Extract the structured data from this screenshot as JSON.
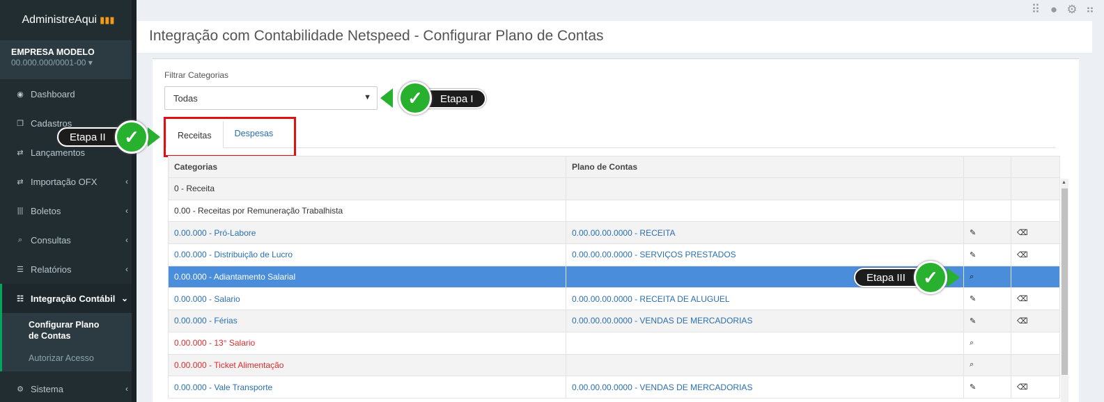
{
  "app": {
    "brand": "AdministreAqui"
  },
  "company": {
    "name": "EMPRESA MODELO",
    "cnpj": "00.000.000/0001-00"
  },
  "sidebar": {
    "items": [
      {
        "label": "Dashboard",
        "icon": "dashboard-icon"
      },
      {
        "label": "Cadastros",
        "icon": "copy-icon"
      },
      {
        "label": "Lançamentos",
        "icon": "exchange-icon"
      },
      {
        "label": "Importação OFX",
        "icon": "exchange-icon"
      },
      {
        "label": "Boletos",
        "icon": "barcode-icon"
      },
      {
        "label": "Consultas",
        "icon": "search-icon"
      },
      {
        "label": "Relatórios",
        "icon": "list-icon"
      },
      {
        "label": "Integração Contábil",
        "icon": "table-icon"
      },
      {
        "label": "Sistema",
        "icon": "gears-icon"
      }
    ],
    "submenu": [
      {
        "label": "Configurar Plano de Contas"
      },
      {
        "label": "Autorizar Acesso"
      }
    ]
  },
  "page": {
    "title": "Integração com Contabilidade Netspeed - Configurar Plano de Contas"
  },
  "filter": {
    "label": "Filtrar Categorias",
    "selected": "Todas"
  },
  "tabs": {
    "receitas": "Receitas",
    "despesas": "Despesas"
  },
  "table": {
    "headers": [
      "Categorias",
      "Plano de Contas",
      "",
      ""
    ],
    "rows": [
      {
        "cat": "0 - Receita",
        "plano": ""
      },
      {
        "cat": "0.00 - Receitas por Remuneração Trabalhista",
        "plano": ""
      },
      {
        "cat": "0.00.000 - Pró-Labore",
        "plano": "0.00.00.00.0000 - RECEITA"
      },
      {
        "cat": "0.00.000 - Distribuição de Lucro",
        "plano": "0.00.00.00.0000 - SERVIÇOS PRESTADOS"
      },
      {
        "cat": "0.00.000 - Adiantamento Salarial",
        "plano": ""
      },
      {
        "cat": "0.00.000 - Salario",
        "plano": "0.00.00.00.0000 - RECEITA DE ALUGUEL"
      },
      {
        "cat": "0.00.000 - Férias",
        "plano": "0.00.00.00.0000 - VENDAS DE MERCADORIAS"
      },
      {
        "cat": "0.00.000 - 13° Salario",
        "plano": ""
      },
      {
        "cat": "0.00.000 - Ticket Alimentação",
        "plano": ""
      },
      {
        "cat": "0.00.000 - Vale Transporte",
        "plano": "0.00.00.00.0000 - VENDAS DE MERCADORIAS"
      }
    ]
  },
  "callouts": {
    "etapa1": "Etapa I",
    "etapa2": "Etapa II",
    "etapa3": "Etapa III"
  },
  "colors": {
    "accent": "#00a65a",
    "selected_row": "#4a8edb",
    "link": "#2a6fb0",
    "warning": "#dd2b2b"
  }
}
